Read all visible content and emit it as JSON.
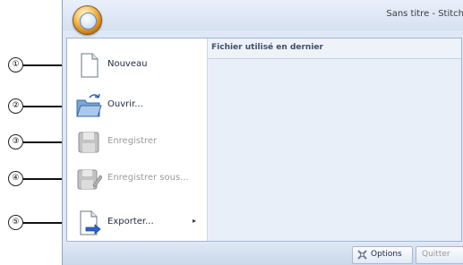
{
  "window": {
    "title": "Sans titre - Stitch"
  },
  "menu": {
    "items": [
      {
        "label": "Nouveau",
        "enabled": true,
        "icon": "new-document-icon",
        "submenu": false
      },
      {
        "label": "Ouvrir...",
        "enabled": true,
        "icon": "open-folder-icon",
        "submenu": false
      },
      {
        "label": "Enregistrer",
        "enabled": false,
        "icon": "save-icon",
        "submenu": false
      },
      {
        "label": "Enregistrer sous...",
        "enabled": false,
        "icon": "save-as-icon",
        "submenu": false
      },
      {
        "label": "Exporter...",
        "enabled": true,
        "icon": "export-icon",
        "submenu": true
      }
    ],
    "submenu_arrow": "▸"
  },
  "recent": {
    "title": "Fichier utilisé en dernier"
  },
  "footer": {
    "options_label": "Options",
    "quit_label": "Quitter"
  },
  "callouts": [
    "①",
    "②",
    "③",
    "④",
    "⑤"
  ]
}
